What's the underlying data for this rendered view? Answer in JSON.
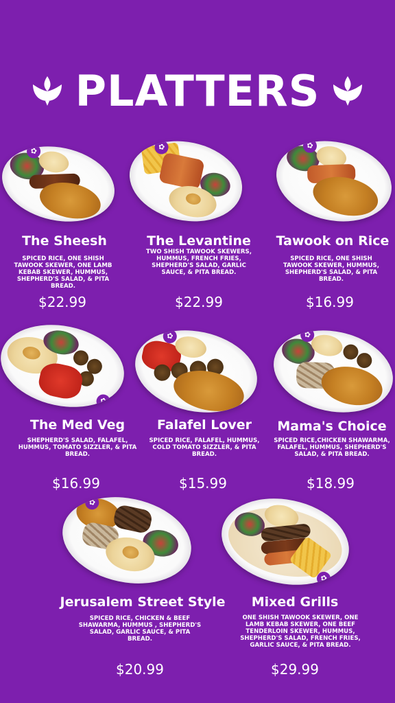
{
  "header": {
    "title": "PLATTERS"
  },
  "colors": {
    "background": "#7d1fae",
    "text": "#ffffff"
  },
  "items": [
    {
      "name": "The Sheesh",
      "description": "SPICED RICE, ONE SHISH TAWOOK SKEWER, ONE LAMB KEBAB SKEWER, HUMMUS, SHEPHERD'S SALAD, & PITA BREAD.",
      "price": "$22.99"
    },
    {
      "name": "The Levantine",
      "description": "TWO SHISH TAWOOK SKEWERS, HUMMUS, FRENCH FRIES, SHEPHERD'S SALAD, GARLIC SAUCE, & PITA BREAD.",
      "price": "$22.99"
    },
    {
      "name": "Tawook on Rice",
      "description": "SPICED RICE, ONE SHISH TAWOOK SKEWER, HUMMUS, SHEPHERD'S SALAD, & PITA BREAD.",
      "price": "$16.99"
    },
    {
      "name": "The Med Veg",
      "description": "SHEPHERD'S SALAD, FALAFEL, HUMMUS, TOMATO SIZZLER, & PITA BREAD.",
      "price": "$16.99"
    },
    {
      "name": "Falafel Lover",
      "description": "SPICED RICE, FALAFEL, HUMMUS, COLD TOMATO SIZZLER, & PITA BREAD.",
      "price": "$15.99"
    },
    {
      "name": "Mama's Choice",
      "description": "SPICED RICE,CHICKEN SHAWARMA, FALAFEL, HUMMUS, SHEPHERD'S SALAD, & PITA BREAD.",
      "price": "$18.99"
    },
    {
      "name": "Jerusalem Street Style",
      "description": "SPICED RICE, CHICKEN & BEEF SHAWARMA, HUMMUS , SHEPHERD'S SALAD, GARLIC SAUCE, & PITA BREAD.",
      "price": "$20.99"
    },
    {
      "name": "Mixed Grills",
      "description": "ONE SHISH TAWOOK SKEWER, ONE LAMB KEBAB SKEWER, ONE BEEF TENDERLOIN SKEWER, HUMMUS, SHEPHERD'S SALAD, FRENCH FRIES, GARLIC SAUCE, & PITA BREAD.",
      "price": "$29.99"
    }
  ]
}
